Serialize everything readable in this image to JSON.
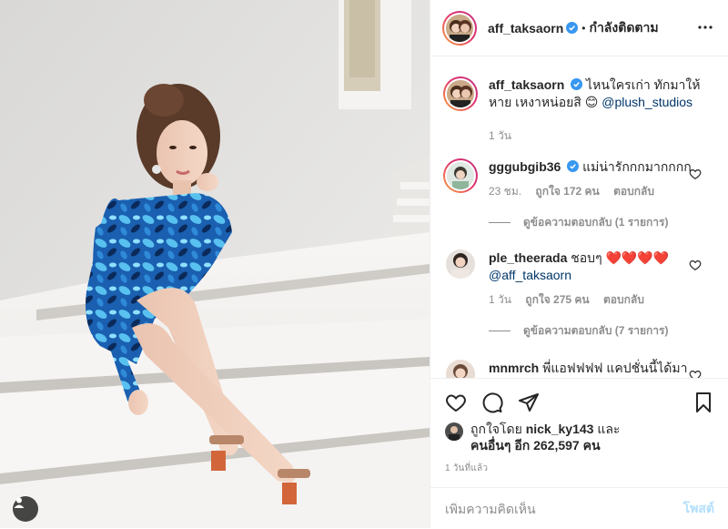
{
  "photo": {
    "user_tag_icon": "user-tag-icon"
  },
  "header": {
    "username": "aff_taksaorn",
    "separator": "•",
    "follow_label": "กำลังติดตาม",
    "more_icon": "more-options-icon"
  },
  "caption": {
    "username": "aff_taksaorn",
    "text": "ไหนใครเก่า ทักมาให้หาย เหงาหน่อยสิ 😊",
    "mention": "@plush_studios",
    "time": "1 วัน"
  },
  "comments": [
    {
      "username": "gggubgib36",
      "text": "แม่น่ารักกกมากกกก",
      "time": "23 ชม.",
      "likes": "ถูกใจ 172 คน",
      "reply_label": "ตอบกลับ",
      "view_replies": "ดูข้อความตอบกลับ (1 รายการ)"
    },
    {
      "username": "ple_theerada",
      "text": "ชอบๆ ❤️❤️❤️❤️",
      "mention": "@aff_taksaorn",
      "time": "1 วัน",
      "likes": "ถูกใจ 275 คน",
      "reply_label": "ตอบกลับ",
      "view_replies": "ดูข้อความตอบกลับ (7 รายการ)"
    },
    {
      "username": "mnmrch",
      "text": "พี่แอฟฟฟฟ แคปชั่นนี้ได้มา"
    }
  ],
  "likes": {
    "prefix": "ถูกใจโดย",
    "liker": "nick_ky143",
    "suffix": "และ",
    "others": "คนอื่นๆ อีก 262,597 คน"
  },
  "posted_time": "1 วันที่แล้ว",
  "add_comment": {
    "placeholder": "เพิ่มความคิดเห็น",
    "post_label": "โพสต์"
  },
  "colors": {
    "accent_link": "#00376b",
    "verified": "#3897f0",
    "heart_red": "#ed4956",
    "post_disabled": "#b2dffc"
  }
}
